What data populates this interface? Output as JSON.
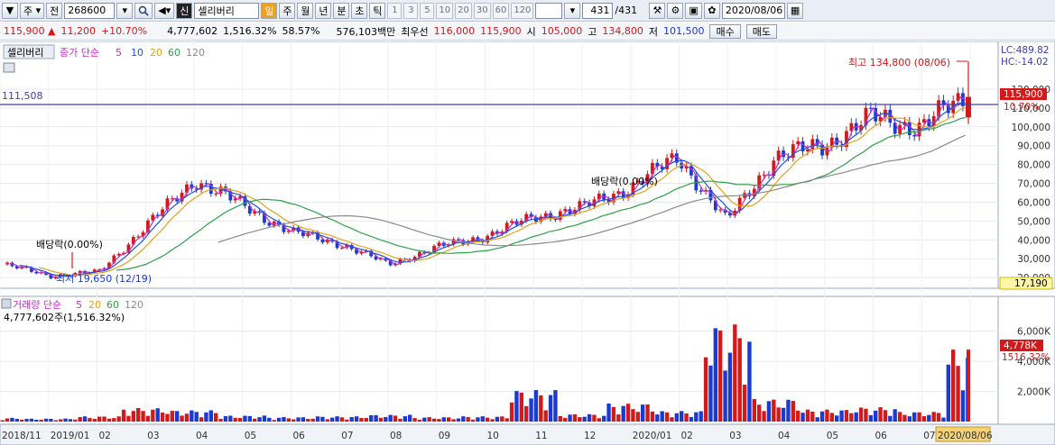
{
  "toolbar": {
    "code_type": "주",
    "code_prefix": "전",
    "code": "268600",
    "name_tag": "신",
    "name": "셀리버리",
    "periods": [
      "일",
      "주",
      "월",
      "년",
      "분",
      "초",
      "틱"
    ],
    "active_period": "일",
    "intervals": [
      "1",
      "3",
      "5",
      "10",
      "20",
      "30",
      "60",
      "120"
    ],
    "count": "431",
    "count_total": "/431",
    "date": "2020/08/06"
  },
  "quote": {
    "price": "115,900 ▲",
    "change": "11,200",
    "change_pct": "+10.70%",
    "volume": "4,777,602",
    "volume_pct": "1,516.32%",
    "rate": "58.57%",
    "amount": "576,103백만",
    "best_label": "최우선",
    "best_ask": "116,000",
    "best_bid": "115,900",
    "open_label": "시",
    "open": "105,000",
    "high_label": "고",
    "high": "134,800",
    "low_label": "저",
    "low": "101,500",
    "buy_label": "매수",
    "sell_label": "매도"
  },
  "price_panel": {
    "legend_name": "셀리버리",
    "legend_ma_label": "종가 단순",
    "legend_ma": [
      "5",
      "10",
      "20",
      "60",
      "120"
    ],
    "hline_label": "111,508",
    "annot_high": "최고 134,800 (08/06)",
    "annot_low": "최저 19,650 (12/19)",
    "annot_div1": "배당락(0.00%)",
    "annot_div2": "배당락(0.00%)",
    "lc": "LC:489.82",
    "hc": "HC:-14.02",
    "price_tag": "115,900",
    "pct_tag": "10.70%",
    "bottom_tag": "17,190"
  },
  "volume_panel": {
    "legend_label": "거래량 단순",
    "legend_ma": [
      "5",
      "20",
      "60",
      "120"
    ],
    "value_label": "4,777,602주(1,516.32%)",
    "vol_tag": "4,778K",
    "vol_pct_tag": "1516.32%"
  },
  "colors": {
    "up": "#d21a1a",
    "down": "#1a3ad2",
    "ma5": "#c72fc7",
    "ma10": "#1f52d6",
    "ma20": "#e2a21a",
    "ma60": "#2ea04a",
    "ma120": "#8a8a8a",
    "hline": "#3f3fb0"
  },
  "chart_data": [
    {
      "type": "line",
      "title": "셀리버리",
      "x": [
        "2018/11",
        "2019/01",
        "02",
        "03",
        "04",
        "05",
        "06",
        "07",
        "08",
        "09",
        "10",
        "11",
        "12",
        "2020/01",
        "02",
        "03",
        "04",
        "05",
        "06",
        "07",
        "2020/08/06"
      ],
      "y_axis_ticks": [
        "20,000",
        "30,000",
        "40,000",
        "50,000",
        "60,000",
        "70,000",
        "80,000",
        "90,000",
        "100,000",
        "110,000",
        "120,000"
      ],
      "ylim": [
        17190,
        134800
      ],
      "series": [
        {
          "name": "종가",
          "values": [
            27000,
            21000,
            23000,
            48000,
            72000,
            58000,
            44000,
            38000,
            27000,
            36000,
            42000,
            52000,
            57000,
            68000,
            84000,
            50000,
            84000,
            90000,
            105000,
            100000,
            115900
          ]
        }
      ],
      "ma_periods": [
        "5",
        "10",
        "20",
        "60",
        "120"
      ]
    },
    {
      "type": "bar",
      "title": "거래량",
      "x": [
        "2018/11",
        "2019/01",
        "02",
        "03",
        "04",
        "05",
        "06",
        "07",
        "08",
        "09",
        "10",
        "11",
        "12",
        "2020/01",
        "02",
        "03",
        "04",
        "05",
        "06",
        "07",
        "2020/08/06"
      ],
      "y_axis_ticks": [
        "2,000K",
        "4,000K",
        "6,000K"
      ],
      "series": [
        {
          "name": "거래량",
          "values": [
            250000,
            200000,
            350000,
            900000,
            750000,
            400000,
            300000,
            350000,
            450000,
            300000,
            350000,
            2100000,
            500000,
            1200000,
            700000,
            6500000,
            1500000,
            800000,
            950000,
            650000,
            4777602
          ]
        }
      ]
    }
  ]
}
